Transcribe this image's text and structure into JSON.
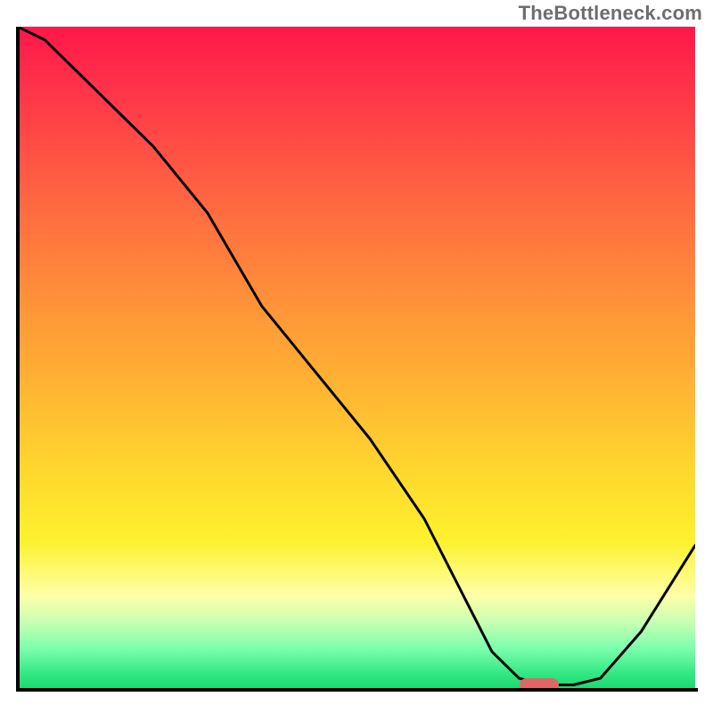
{
  "watermark": "TheBottleneck.com",
  "chart_data": {
    "type": "line",
    "title": "",
    "xlabel": "",
    "ylabel": "",
    "x_range": [
      0,
      100
    ],
    "y_range": [
      0,
      100
    ],
    "series": [
      {
        "name": "bottleneck-curve",
        "x": [
          0,
          4,
          12,
          20,
          28,
          36,
          44,
          52,
          60,
          66,
          70,
          74,
          78,
          82,
          86,
          92,
          100
        ],
        "y": [
          100,
          98,
          90,
          82,
          72,
          58,
          48,
          38,
          26,
          14,
          6,
          2,
          1,
          1,
          2,
          9,
          22
        ]
      }
    ],
    "marker": {
      "name": "optimal-point",
      "x": 77,
      "y": 1,
      "color": "#e06666"
    },
    "background_gradient": {
      "orientation": "vertical",
      "stops": [
        {
          "pos": 0.0,
          "color": "#ff1749"
        },
        {
          "pos": 0.38,
          "color": "#ff883b"
        },
        {
          "pos": 0.68,
          "color": "#ffd92e"
        },
        {
          "pos": 0.86,
          "color": "#feffa7"
        },
        {
          "pos": 1.0,
          "color": "#1fd973"
        }
      ]
    }
  }
}
